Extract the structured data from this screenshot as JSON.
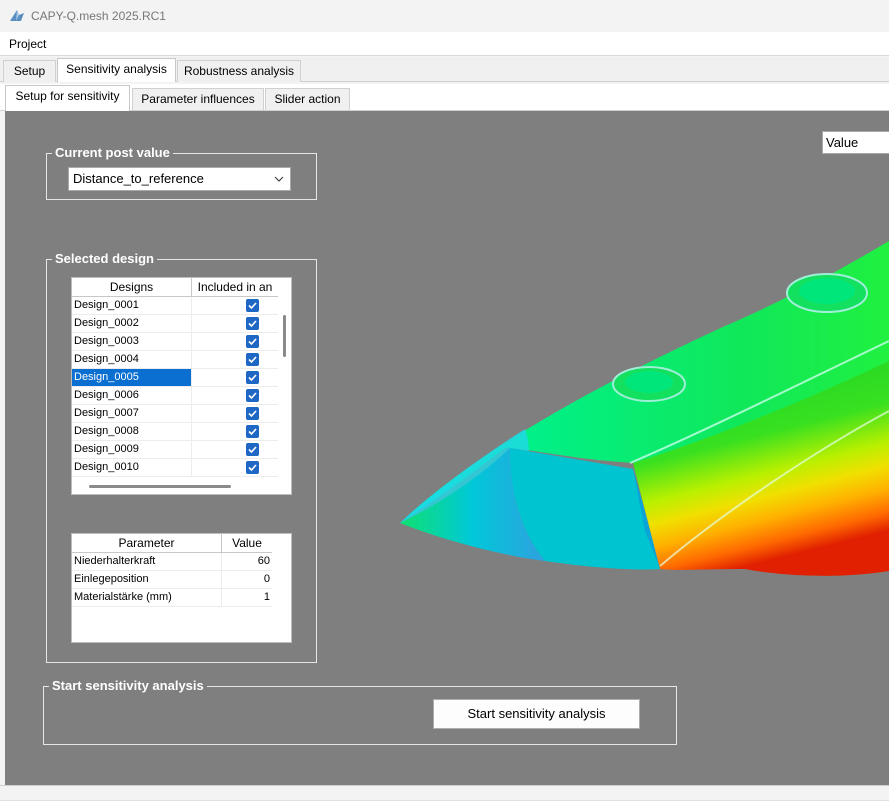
{
  "window": {
    "title": "CAPY-Q.mesh 2025.RC1"
  },
  "menu": {
    "items": [
      "Project"
    ]
  },
  "main_tabs": [
    {
      "label": "Setup",
      "active": false
    },
    {
      "label": "Sensitivity analysis",
      "active": true
    },
    {
      "label": "Robustness analysis",
      "active": false
    }
  ],
  "sub_tabs": [
    {
      "label": "Setup for sensitivity",
      "active": true
    },
    {
      "label": "Parameter influences",
      "active": false
    },
    {
      "label": "Slider action",
      "active": false
    }
  ],
  "post_value": {
    "group_title": "Current post value",
    "selected": "Distance_to_reference"
  },
  "selected_design": {
    "group_title": "Selected design",
    "columns": [
      "Designs",
      "Included in an"
    ],
    "rows": [
      {
        "name": "Design_0001",
        "included": true,
        "selected": false
      },
      {
        "name": "Design_0002",
        "included": true,
        "selected": false
      },
      {
        "name": "Design_0003",
        "included": true,
        "selected": false
      },
      {
        "name": "Design_0004",
        "included": true,
        "selected": false
      },
      {
        "name": "Design_0005",
        "included": true,
        "selected": true
      },
      {
        "name": "Design_0006",
        "included": true,
        "selected": false
      },
      {
        "name": "Design_0007",
        "included": true,
        "selected": false
      },
      {
        "name": "Design_0008",
        "included": true,
        "selected": false
      },
      {
        "name": "Design_0009",
        "included": true,
        "selected": false
      },
      {
        "name": "Design_0010",
        "included": true,
        "selected": false
      }
    ]
  },
  "parameters": {
    "columns": [
      "Parameter",
      "Value"
    ],
    "rows": [
      {
        "name": "Niederhalterkraft",
        "value": "60"
      },
      {
        "name": "Einlegeposition",
        "value": "0"
      },
      {
        "name": "Materialstärke (mm)",
        "value": "1"
      }
    ]
  },
  "start": {
    "group_title": "Start sensitivity analysis",
    "button_label": "Start sensitivity analysis"
  },
  "viewport": {
    "value_box": "Value",
    "background": "#7f7f7f"
  },
  "colors": {
    "accent": "#0a6fd0",
    "checkbox": "#1e67c4"
  }
}
